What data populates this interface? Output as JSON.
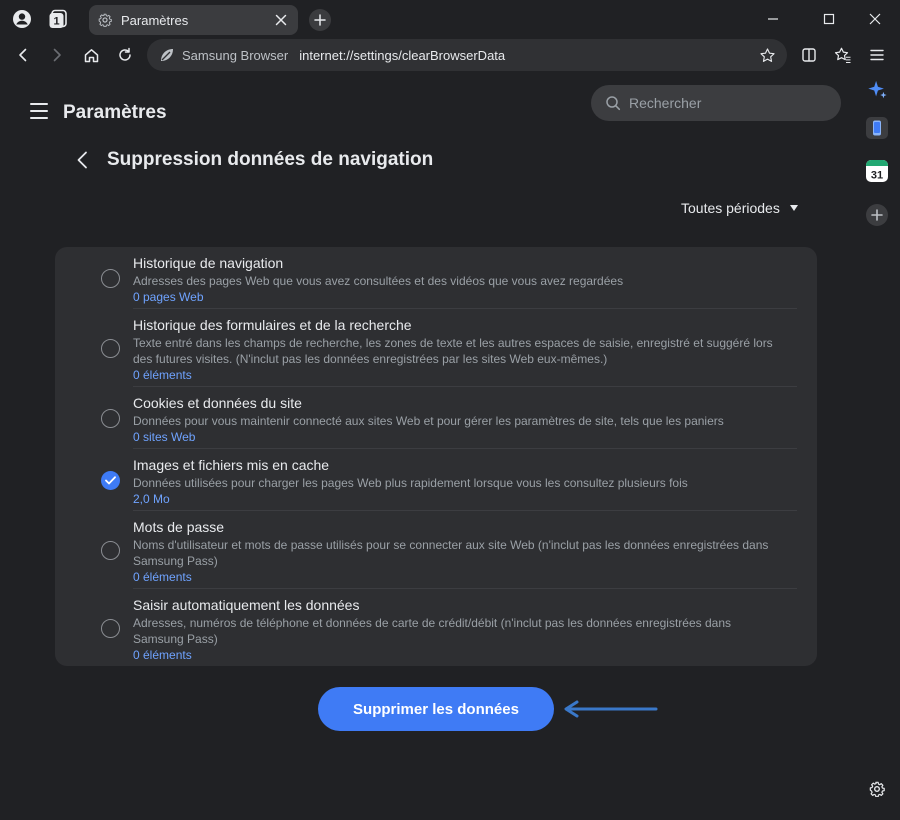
{
  "browser": {
    "tab_count": "1",
    "tab_title": "Paramètres",
    "brand_label": "Samsung Browser",
    "url": "internet://settings/clearBrowserData"
  },
  "settings": {
    "title": "Paramètres",
    "search_placeholder": "Rechercher"
  },
  "page": {
    "title": "Suppression données de navigation",
    "period_label": "Toutes périodes",
    "delete_label": "Supprimer les données"
  },
  "items": [
    {
      "title": "Historique de navigation",
      "description": "Adresses des pages Web que vous avez consultées et des vidéos que vous avez regardées",
      "count": "0 pages Web",
      "checked": false
    },
    {
      "title": "Historique des formulaires et de la recherche",
      "description": "Texte entré dans les champs de recherche, les zones de texte et les autres espaces de saisie, enregistré et suggéré lors des futures visites. (N'inclut pas les données enregistrées par les sites Web eux-mêmes.)",
      "count": "0 éléments",
      "checked": false
    },
    {
      "title": "Cookies et données du site",
      "description": "Données pour vous maintenir connecté aux sites Web et pour gérer les paramètres de site, tels que les paniers",
      "count": "0 sites Web",
      "checked": false
    },
    {
      "title": "Images et fichiers mis en cache",
      "description": "Données utilisées pour charger les pages Web plus rapidement lorsque vous les consultez plusieurs fois",
      "count": "2,0 Mo",
      "checked": true
    },
    {
      "title": "Mots de passe",
      "description": "Noms d'utilisateur et mots de passe utilisés pour se connecter aux site Web (n'inclut pas les données enregistrées dans Samsung Pass)",
      "count": "0 éléments",
      "checked": false
    },
    {
      "title": "Saisir automatiquement les données",
      "description": "Adresses, numéros de téléphone et données de carte de crédit/débit (n'inclut pas les données enregistrées dans Samsung Pass)",
      "count": "0 éléments",
      "checked": false
    }
  ],
  "side_panel": {
    "calendar_day": "31"
  },
  "colors": {
    "accent": "#3f7bf5",
    "link": "#6fa3ff",
    "background": "#202124",
    "card": "#2e2f32",
    "arrow": "#3a78c9"
  },
  "icons": {
    "profile": "profile-icon",
    "tab_counter": "tab-counter-icon",
    "settings_tab": "gear-icon",
    "close": "close-icon",
    "new_tab": "plus-icon",
    "back": "arrow-left-icon",
    "forward": "arrow-right-icon",
    "home": "home-icon",
    "reload": "reload-icon",
    "bookmark": "star-icon",
    "sidebar": "sidebar-icon",
    "bookmarks_list": "star-list-icon",
    "menu": "menu-icon",
    "search": "search-icon",
    "check": "check-icon",
    "caret": "caret-down-icon",
    "copilot": "sparkle-icon",
    "phone": "phone-icon",
    "calendar": "calendar-icon",
    "add": "add-icon",
    "settings": "gear-icon"
  }
}
